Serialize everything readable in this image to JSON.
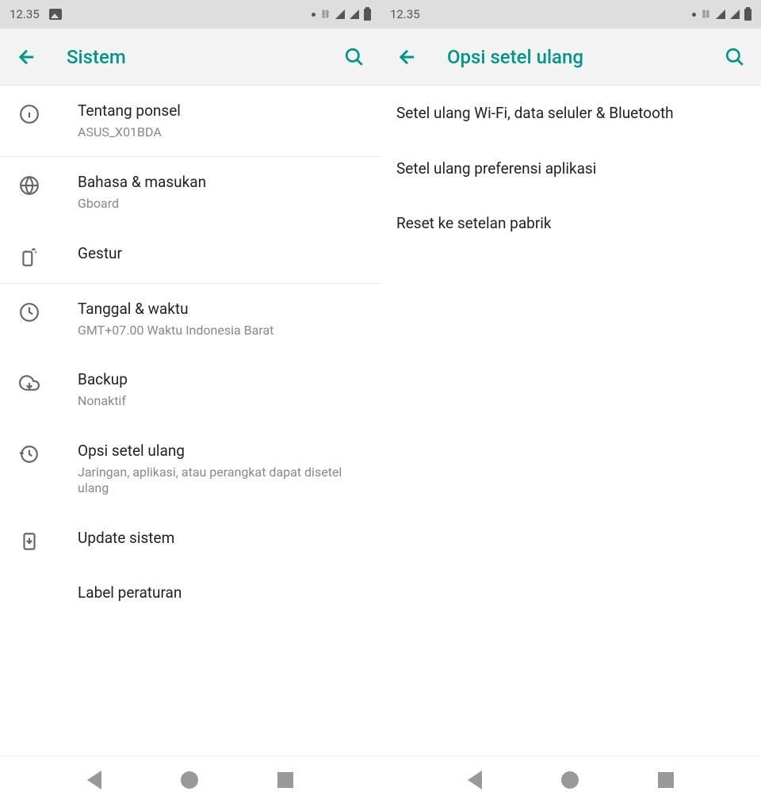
{
  "status": {
    "time": "12.35"
  },
  "left": {
    "title": "Sistem",
    "items": [
      {
        "title": "Tentang ponsel",
        "subtitle": "ASUS_X01BDA",
        "icon": "info"
      },
      {
        "title": "Bahasa & masukan",
        "subtitle": "Gboard",
        "icon": "globe"
      },
      {
        "title": "Gestur",
        "subtitle": "",
        "icon": "gesture"
      },
      {
        "title": "Tanggal & waktu",
        "subtitle": "GMT+07.00 Waktu Indonesia Barat",
        "icon": "clock"
      },
      {
        "title": "Backup",
        "subtitle": "Nonaktif",
        "icon": "cloud"
      },
      {
        "title": "Opsi setel ulang",
        "subtitle": "Jaringan, aplikasi, atau perangkat dapat disetel ulang",
        "icon": "history"
      },
      {
        "title": "Update sistem",
        "subtitle": "",
        "icon": "update"
      },
      {
        "title": "Label peraturan",
        "subtitle": "",
        "icon": ""
      }
    ]
  },
  "right": {
    "title": "Opsi setel ulang",
    "items": [
      {
        "title": "Setel ulang Wi-Fi, data seluler & Bluetooth"
      },
      {
        "title": "Setel ulang preferensi aplikasi"
      },
      {
        "title": "Reset ke setelan pabrik"
      }
    ]
  }
}
